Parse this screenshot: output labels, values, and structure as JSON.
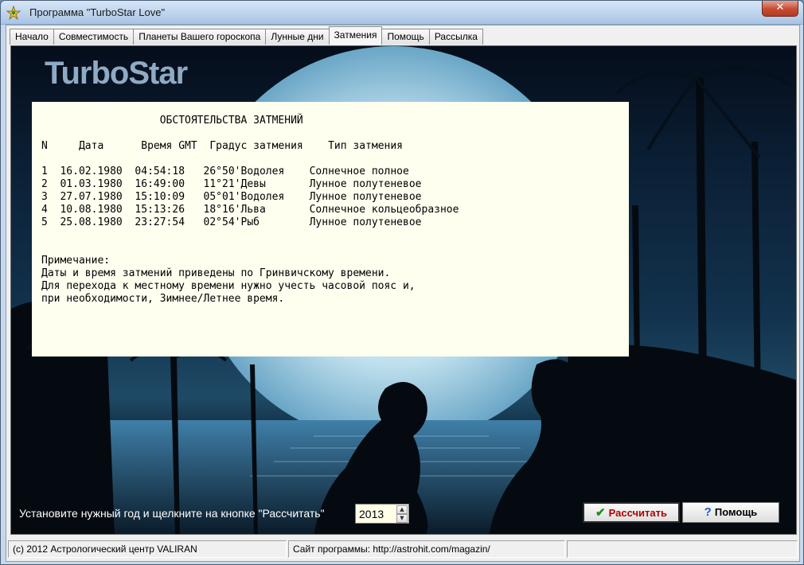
{
  "window": {
    "title": "Программа \"TurboStar Love\"",
    "close_label": "✕"
  },
  "tabs": [
    {
      "label": "Начало"
    },
    {
      "label": "Совместимость"
    },
    {
      "label": "Планеты Вашего гороскопа"
    },
    {
      "label": "Лунные дни"
    },
    {
      "label": "Затмения",
      "active": true
    },
    {
      "label": "Помощь"
    },
    {
      "label": "Рассылка"
    }
  ],
  "logo": "TurboStar",
  "report": {
    "heading": "ОБСТОЯТЕЛЬСТВА ЗАТМЕНИЙ",
    "columns": [
      "N",
      "Дата",
      "Время GMT",
      "Градус затмения",
      "Тип затмения"
    ],
    "rows": [
      [
        "1",
        "16.02.1980",
        "04:54:18",
        "26°50'Водолея",
        "Солнечное полное"
      ],
      [
        "2",
        "01.03.1980",
        "16:49:00",
        "11°21'Девы",
        "Лунное полутеневое"
      ],
      [
        "3",
        "27.07.1980",
        "15:10:09",
        "05°01'Водолея",
        "Лунное полутеневое"
      ],
      [
        "4",
        "10.08.1980",
        "15:13:26",
        "18°16'Льва",
        "Солнечное кольцеобразное"
      ],
      [
        "5",
        "25.08.1980",
        "23:27:54",
        "02°54'Рыб",
        "Лунное полутеневое"
      ]
    ],
    "note_title": "Примечание:",
    "note_lines": [
      "Даты и время затмений приведены по Гринвичскому времени.",
      "Для перехода к местному времени нужно учесть часовой пояс и,",
      "при необходимости, Зимнее/Летнее время."
    ]
  },
  "controls": {
    "prompt": "Установите нужный год и щелкните на кнопке \"Рассчитать\"",
    "year_value": "2013",
    "calc_label": "Рассчитать",
    "help_label": "Помощь"
  },
  "statusbar": {
    "copyright": "(c) 2012 Астрологический центр VALIRAN",
    "site": "Сайт программы:  http://astrohit.com/magazin/",
    "empty": ""
  },
  "colors": {
    "report_bg": "#fffff0",
    "calc_text": "#b00000",
    "scene_top": "#050d1a",
    "moon": "#cfe6f2"
  }
}
